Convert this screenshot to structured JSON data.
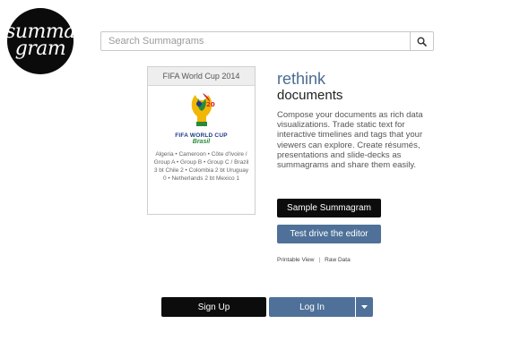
{
  "logo": {
    "line1": "sum",
    "line2": "ma",
    "line3": "gram"
  },
  "search": {
    "placeholder": "Search Summagrams",
    "icon": "search-icon"
  },
  "featured": {
    "title": "FIFA World Cup 2014",
    "emblem_line1": "FIFA WORLD CUP",
    "emblem_line2": "Brasil",
    "tags": "Algeria • Cameroon • Côte d'Ivoire / Group A • Group B • Group C / Brazil 3 bt Chile 2 • Colombia 2 bt Uruguay 0 • Netherlands 2 bt Mexico 1"
  },
  "tagline": {
    "line1": "rethink",
    "line2": "documents"
  },
  "description": "Compose your documents as rich data visualizations. Trade static text for interactive timelines and tags that your viewers can explore. Create résumés, presentations and slide-decks as summagrams and share them easily.",
  "buttons": {
    "sample": "Sample Summagram",
    "test_drive": "Test drive the editor",
    "sign_up": "Sign Up",
    "log_in": "Log In"
  },
  "links": {
    "printable": "Printable View",
    "separator": "|",
    "raw": "Raw Data"
  },
  "colors": {
    "accent_blue": "#4f7199",
    "dark": "#0c0c0c",
    "heading_blue": "#4a6d93"
  }
}
